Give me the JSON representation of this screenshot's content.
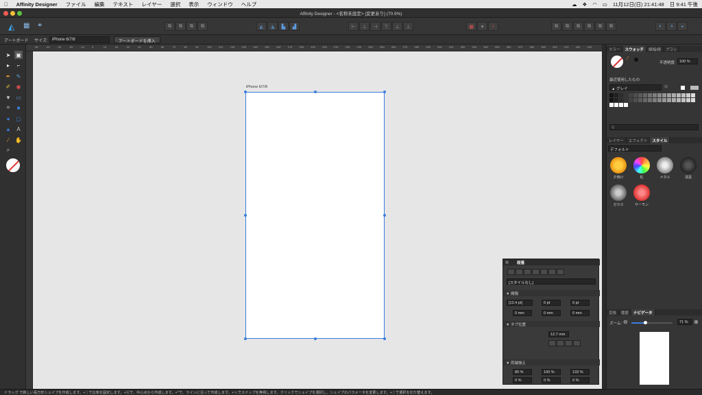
{
  "menubar": {
    "app": "Affinity Designer",
    "items": [
      "ファイル",
      "編集",
      "テキスト",
      "レイヤー",
      "選択",
      "表示",
      "ウィンドウ",
      "ヘルプ"
    ],
    "date": "11月12日(日) 21:41:48",
    "time": "日 9:41 午後"
  },
  "window": {
    "title": "Affinity Designer - <名称未設定> [変更あり] (70.9%)"
  },
  "context": {
    "artboard_label": "アートボード",
    "size_label": "サイズ:",
    "size_value": "iPhone 6/7/8",
    "insert_button": "アートボードを挿入"
  },
  "ruler": {
    "ticks": [
      "-50",
      "-40",
      "-30",
      "-20",
      "-10",
      "0",
      "10",
      "20",
      "30",
      "40",
      "50",
      "60",
      "70",
      "80",
      "90",
      "100",
      "110",
      "120",
      "130",
      "140",
      "150",
      "160",
      "170",
      "180",
      "190",
      "200",
      "210",
      "220",
      "230",
      "240",
      "250",
      "260",
      "270",
      "280",
      "290",
      "300",
      "310",
      "320",
      "330",
      "340",
      "350",
      "360",
      "370",
      "380",
      "390",
      "400",
      "410",
      "420",
      "430"
    ]
  },
  "artboard": {
    "name": "iPhone 6/7/8"
  },
  "swatches_panel": {
    "tabs": [
      "カラー",
      "スウォッチ",
      "線幅/線",
      "ブラシ"
    ],
    "active_tab": "スウォッチ",
    "opacity_label": "不透明度:",
    "opacity_value": "100 %",
    "recent_label": "最近使用したもの:",
    "palette": "グレイ",
    "search_placeholder": "Q"
  },
  "styles_panel": {
    "tabs": [
      "レイヤー",
      "エフェクト",
      "スタイル"
    ],
    "active_tab": "スタイル",
    "category": "デフォルト",
    "items": [
      {
        "name": "夕焼け",
        "color": "#f0a020"
      },
      {
        "name": "虹",
        "color": "#c040e0"
      },
      {
        "name": "メタル",
        "color": "#a0a0a0"
      },
      {
        "name": "漆黒",
        "color": "#333333"
      },
      {
        "name": "ガラス",
        "color": "#888888"
      },
      {
        "name": "サーモン",
        "color": "#e05050"
      }
    ]
  },
  "navigator_panel": {
    "tabs": [
      "変換",
      "履歴",
      "ナビゲータ"
    ],
    "active_tab": "ナビゲータ",
    "zoom_label": "ズーム:",
    "zoom_value": "71 %"
  },
  "typography_panel": {
    "title": "段落",
    "style_value": "[スタイルなし]",
    "spacing_section": "間隔",
    "line_height": "[12.4 pt]",
    "space_before": "0 pt",
    "space_after": "0 pt",
    "left_indent": "0 mm",
    "first_indent": "0 mm",
    "right_indent": "0 mm",
    "tabs_section": "タブ位置",
    "tab_value": "12.7 mm",
    "justify_section": "両端揃え",
    "word_spacing": "80 %",
    "letter_spacing": "100 %",
    "glyph_scale": "133 %",
    "v1": "0 %",
    "v2": "0 %",
    "v3": "0 %"
  },
  "status": {
    "text": "ドラッグ で新しい長方形シェイプを作成します。+⇧で比率を固定します。+⌘で、中心点から作成します。+^で、ラインに沿って作成します。+⌥でスナップを無視します。クリックでシェイプを選択し、シェイプのパラメータを変更します。+⇧で選択を切り替えます。"
  },
  "colors": {
    "accent": "#3b7ddd",
    "canvas": "#e6e6e6",
    "panel": "#353535"
  }
}
